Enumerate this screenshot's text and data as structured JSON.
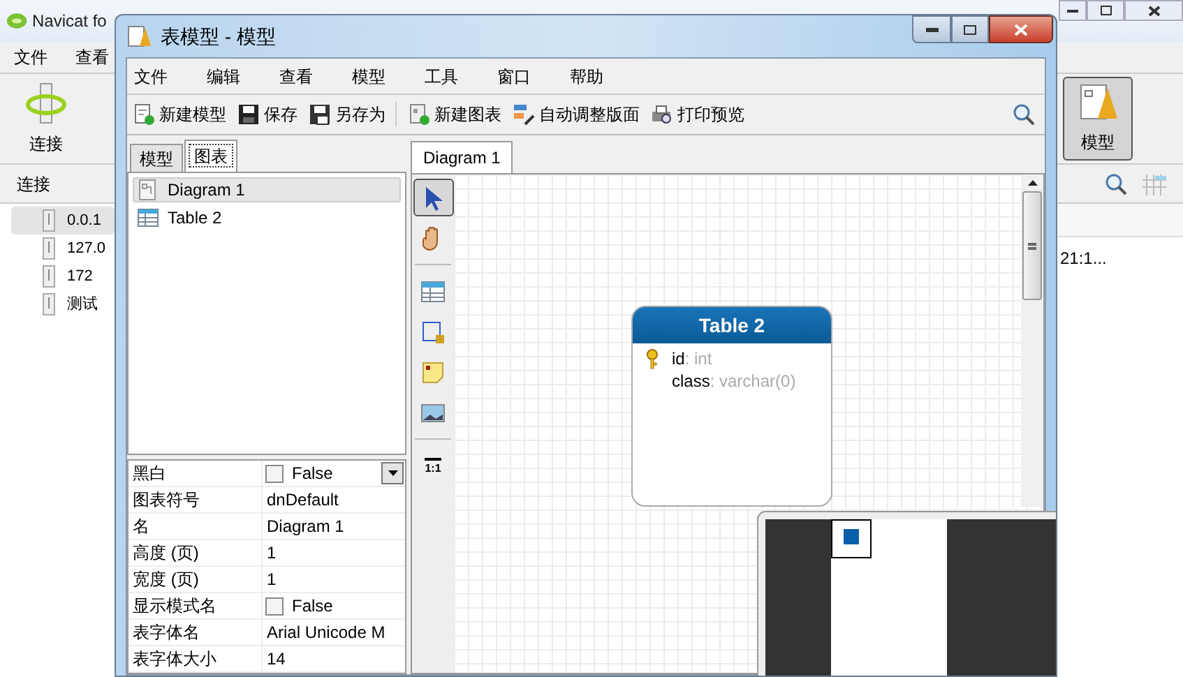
{
  "main_window": {
    "title": "Navicat fo",
    "menu": [
      "文件",
      "查看"
    ],
    "toolbar": [
      {
        "label": "连接",
        "kind": "connect",
        "selected": false
      },
      {
        "label": "模型",
        "kind": "model",
        "selected": true
      }
    ],
    "section_label": "连接",
    "connections": [
      {
        "label": "0.0.1",
        "selected": true
      },
      {
        "label": "127.0",
        "selected": false
      },
      {
        "label": "172",
        "selected": false
      },
      {
        "label": "测试",
        "selected": false
      }
    ],
    "cell": "21:1..."
  },
  "model_window": {
    "title": "表模型 - 模型",
    "menu": [
      "文件",
      "编辑",
      "查看",
      "模型",
      "工具",
      "窗口",
      "帮助"
    ],
    "toolbar_groups": [
      [
        {
          "label": "新建模型",
          "kind": "new-model"
        },
        {
          "label": "保存",
          "kind": "save"
        },
        {
          "label": "另存为",
          "kind": "save-as"
        }
      ],
      [
        {
          "label": "新建图表",
          "kind": "new-diagram"
        },
        {
          "label": "自动调整版面",
          "kind": "layout"
        },
        {
          "label": "打印预览",
          "kind": "print"
        }
      ]
    ],
    "panel_tabs": [
      {
        "label": "模型",
        "selected": false
      },
      {
        "label": "图表",
        "selected": true
      }
    ],
    "tree": [
      {
        "label": "Diagram 1",
        "kind": "diagram",
        "selected": true
      },
      {
        "label": "Table 2",
        "kind": "table",
        "selected": false
      }
    ],
    "properties": [
      {
        "name": "黑白",
        "kind": "checkbox",
        "checked": false,
        "value": "False",
        "dropdown": true
      },
      {
        "name": "图表符号",
        "kind": "text",
        "value": "dnDefault"
      },
      {
        "name": "名",
        "kind": "text",
        "value": "Diagram 1"
      },
      {
        "name": "高度 (页)",
        "kind": "text",
        "value": "1"
      },
      {
        "name": "宽度 (页)",
        "kind": "text",
        "value": "1"
      },
      {
        "name": "显示模式名",
        "kind": "checkbox",
        "checked": false,
        "value": "False",
        "dropdown": false
      },
      {
        "name": "表字体名",
        "kind": "text",
        "value": "Arial Unicode M"
      },
      {
        "name": "表字体大小",
        "kind": "text",
        "value": "14"
      }
    ],
    "diagram_tabs": [
      {
        "label": "Diagram 1",
        "selected": true
      }
    ],
    "tools": [
      {
        "kind": "pointer",
        "selected": true
      },
      {
        "kind": "hand",
        "selected": false
      },
      {
        "kind": "separator"
      },
      {
        "kind": "table",
        "selected": false
      },
      {
        "kind": "layer",
        "selected": false
      },
      {
        "kind": "note",
        "selected": false
      },
      {
        "kind": "image",
        "selected": false
      },
      {
        "kind": "separator"
      },
      {
        "kind": "zoom",
        "label": "1:1",
        "selected": false
      }
    ],
    "entity": {
      "title": "Table 2",
      "fields": [
        {
          "name": "id",
          "type": ": int",
          "primary_key": true
        },
        {
          "name": "class",
          "type": ": varchar(0)",
          "primary_key": false
        }
      ]
    }
  }
}
